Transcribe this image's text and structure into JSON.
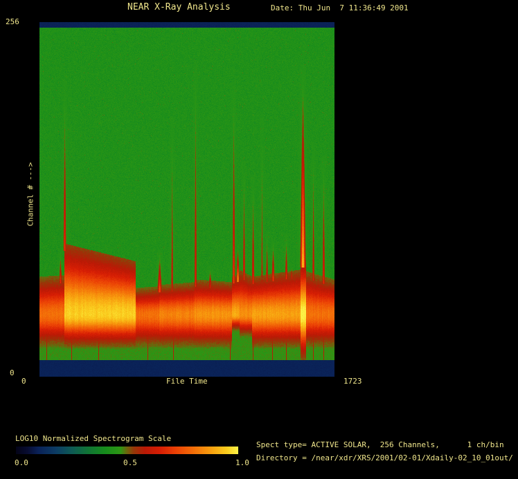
{
  "header": {
    "title": "NEAR X-Ray Analysis",
    "date_label": "Date: Thu Jun  7 11:36:49 2001"
  },
  "axes": {
    "y_top_label": "256",
    "y_bottom_label": "0",
    "y_axis_label": "Channel # --->",
    "x_left_label": "0",
    "x_right_label": "1723",
    "x_axis_label": "File Time"
  },
  "colorbar": {
    "label": "LOG10 Normalized Spectrogram Scale",
    "tick_left": "0.0",
    "tick_mid": "0.5",
    "tick_right": "1.0"
  },
  "info": {
    "spect_line": "Spect type= ACTIVE SOLAR,  256 Channels,      1 ch/bin",
    "directory_line": "Directory = /near/xdr/XRS/2001/02-01/Xdaily-02_10_01out/"
  },
  "colors": {
    "text": "#f0e68c",
    "background": "#000000",
    "border_band_navy": "#0c2а5e",
    "background_green": "#209a1c",
    "flare_red": "#d71e04",
    "core_yellow": "#f8e040"
  },
  "chart_data": {
    "type": "heatmap",
    "title": "NEAR X-Ray Analysis",
    "subtitle": "Date: Thu Jun  7 11:36:49 2001",
    "xlabel": "File Time",
    "ylabel": "Channel # --->",
    "xlim": [
      0,
      1723
    ],
    "ylim": [
      0,
      256
    ],
    "channels": 256,
    "ch_per_bin": 1,
    "spect_type": "ACTIVE SOLAR",
    "colorbar": {
      "label": "LOG10 Normalized Spectrogram Scale",
      "ticks": [
        0.0,
        0.5,
        1.0
      ]
    },
    "legend_position": "bottom-left",
    "grid": false,
    "background_value": 0.43,
    "border_value": 0.1,
    "band": {
      "description": "continuous low-channel emission band",
      "core_channel": 45,
      "bottom_channel": 22,
      "segments": [
        {
          "t0": 0,
          "t1": 145,
          "top_ch_start": 70,
          "top_ch_end": 71,
          "core": 0.8
        },
        {
          "t0": 145,
          "t1": 563,
          "top_ch_start": 94,
          "top_ch_end": 81,
          "core": 0.95
        },
        {
          "t0": 563,
          "t1": 698,
          "top_ch_start": 62,
          "top_ch_end": 63,
          "core": 0.8
        },
        {
          "t0": 698,
          "t1": 905,
          "top_ch_start": 64,
          "top_ch_end": 66,
          "core": 0.83
        },
        {
          "t0": 905,
          "t1": 1125,
          "top_ch_start": 68,
          "top_ch_end": 66,
          "core": 0.86
        },
        {
          "t0": 1125,
          "t1": 1170,
          "top_ch_start": 70,
          "top_ch_end": 72,
          "core": 0.9,
          "bottom_ch": 34
        },
        {
          "t0": 1170,
          "t1": 1242,
          "top_ch_start": 75,
          "top_ch_end": 70,
          "core": 0.85,
          "bottom_ch": 30
        },
        {
          "t0": 1242,
          "t1": 1524,
          "top_ch_start": 70,
          "top_ch_end": 75,
          "core": 0.88
        },
        {
          "t0": 1524,
          "t1": 1556,
          "top_ch_start": 82,
          "top_ch_end": 82,
          "core": 1.0,
          "bottom_ch": 12
        },
        {
          "t0": 1556,
          "t1": 1723,
          "top_ch_start": 74,
          "top_ch_end": 68,
          "core": 0.8
        }
      ]
    },
    "flares": [
      {
        "t": 121,
        "top_ch": 92,
        "width": 12,
        "strength": 0.5
      },
      {
        "t": 146,
        "top_ch": 214,
        "width": 13,
        "strength": 0.55
      },
      {
        "t": 700,
        "top_ch": 92,
        "width": 22,
        "strength": 0.6
      },
      {
        "t": 773,
        "top_ch": 188,
        "width": 7,
        "strength": 0.4
      },
      {
        "t": 910,
        "top_ch": 228,
        "width": 10,
        "strength": 0.5
      },
      {
        "t": 995,
        "top_ch": 80,
        "width": 16,
        "strength": 0.4
      },
      {
        "t": 1133,
        "top_ch": 214,
        "width": 12,
        "strength": 0.6
      },
      {
        "t": 1157,
        "top_ch": 96,
        "width": 13,
        "strength": 0.9
      },
      {
        "t": 1193,
        "top_ch": 156,
        "width": 10,
        "strength": 0.5
      },
      {
        "t": 1246,
        "top_ch": 146,
        "width": 12,
        "strength": 0.5
      },
      {
        "t": 1298,
        "top_ch": 190,
        "width": 6,
        "strength": 0.3
      },
      {
        "t": 1327,
        "top_ch": 106,
        "width": 10,
        "strength": 0.45
      },
      {
        "t": 1363,
        "top_ch": 100,
        "width": 14,
        "strength": 0.55
      },
      {
        "t": 1440,
        "top_ch": 104,
        "width": 12,
        "strength": 0.5
      },
      {
        "t": 1472,
        "top_ch": 80,
        "width": 8,
        "strength": 0.4
      },
      {
        "t": 1537,
        "top_ch": 226,
        "width": 26,
        "strength": 1.0
      },
      {
        "t": 1598,
        "top_ch": 170,
        "width": 8,
        "strength": 0.45
      },
      {
        "t": 1658,
        "top_ch": 160,
        "width": 12,
        "strength": 0.5
      }
    ],
    "drop_lines": [
      40,
      186,
      344,
      631,
      781,
      1112,
      1246,
      1359,
      1440,
      1598,
      1658
    ]
  }
}
